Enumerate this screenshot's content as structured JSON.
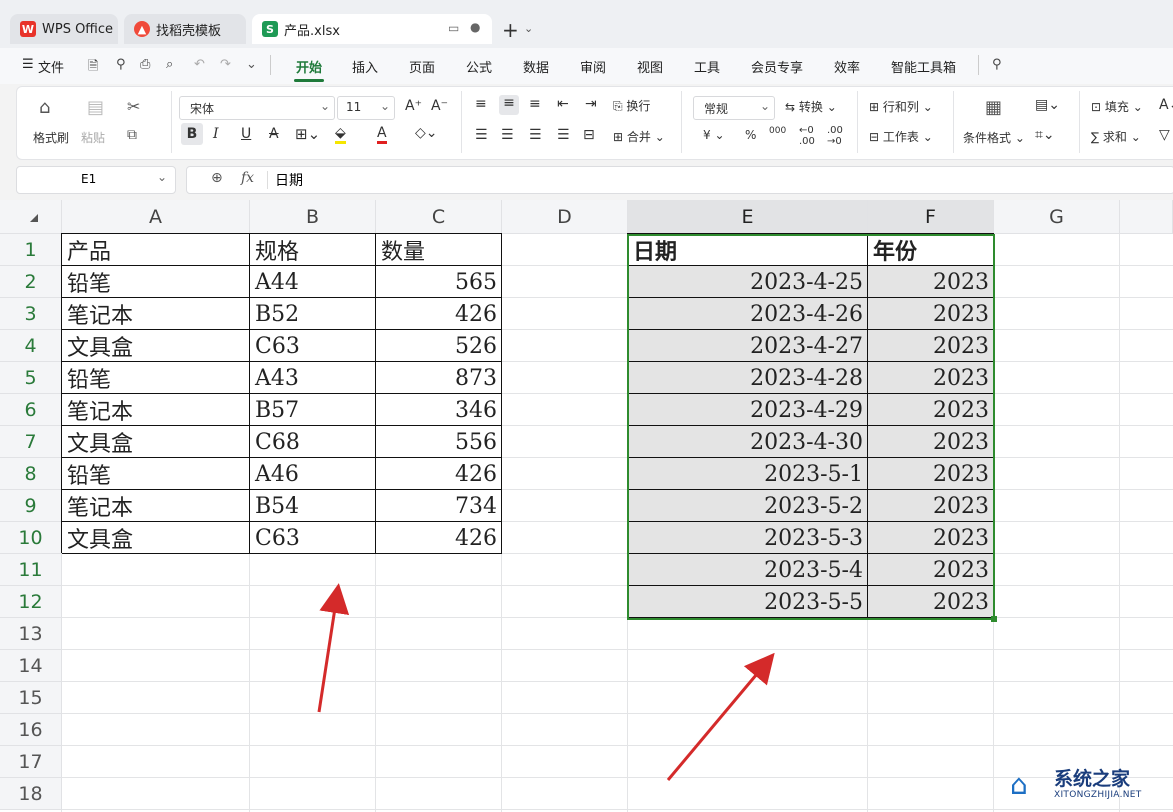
{
  "tabs": [
    {
      "label": "WPS Office",
      "icon": "wps-logo-icon"
    },
    {
      "label": "找稻壳模板",
      "icon": "docer-icon"
    },
    {
      "label": "产品.xlsx",
      "icon": "spreadsheet-icon"
    }
  ],
  "menu": {
    "file": "文件",
    "items": [
      "开始",
      "插入",
      "页面",
      "公式",
      "数据",
      "审阅",
      "视图",
      "工具",
      "会员专享",
      "效率",
      "智能工具箱"
    ],
    "active": "开始"
  },
  "ribbon": {
    "format_painter": "格式刷",
    "paste": "粘贴",
    "font_name": "宋体",
    "font_size": "11",
    "bold": "B",
    "italic": "I",
    "underline": "U",
    "strike": "A",
    "wrap": "换行",
    "merge": "合并",
    "number_format": "常规",
    "convert": "转换",
    "rows_cols": "行和列",
    "worksheet": "工作表",
    "conditional_format": "条件格式",
    "fill": "填充",
    "sum": "求和",
    "currency": "¥",
    "percent": "%",
    "thousands": "000"
  },
  "formula_bar": {
    "name_box": "E1",
    "fx": "fx",
    "content": "日期"
  },
  "columns": [
    "A",
    "B",
    "C",
    "D",
    "E",
    "F",
    "G"
  ],
  "rows": [
    "1",
    "2",
    "3",
    "4",
    "5",
    "6",
    "7",
    "8",
    "9",
    "10",
    "11",
    "12",
    "13",
    "14",
    "15",
    "16",
    "17",
    "18"
  ],
  "table_left": {
    "headers": [
      "产品",
      "规格",
      "数量"
    ],
    "rows": [
      [
        "铅笔",
        "A44",
        "565"
      ],
      [
        "笔记本",
        "B52",
        "426"
      ],
      [
        "文具盒",
        "C63",
        "526"
      ],
      [
        "铅笔",
        "A43",
        "873"
      ],
      [
        "笔记本",
        "B57",
        "346"
      ],
      [
        "文具盒",
        "C68",
        "556"
      ],
      [
        "铅笔",
        "A46",
        "426"
      ],
      [
        "笔记本",
        "B54",
        "734"
      ],
      [
        "文具盒",
        "C63",
        "426"
      ]
    ]
  },
  "table_right": {
    "headers": [
      "日期",
      "年份"
    ],
    "rows": [
      [
        "2023-4-25",
        "2023"
      ],
      [
        "2023-4-26",
        "2023"
      ],
      [
        "2023-4-27",
        "2023"
      ],
      [
        "2023-4-28",
        "2023"
      ],
      [
        "2023-4-29",
        "2023"
      ],
      [
        "2023-4-30",
        "2023"
      ],
      [
        "2023-5-1",
        "2023"
      ],
      [
        "2023-5-2",
        "2023"
      ],
      [
        "2023-5-3",
        "2023"
      ],
      [
        "2023-5-4",
        "2023"
      ],
      [
        "2023-5-5",
        "2023"
      ]
    ]
  },
  "watermark": {
    "title": "系统之家",
    "url": "XITONGZHIJIA.NET"
  },
  "colors": {
    "accent_green": "#1f7a3a",
    "selection_border": "#2e8b2e",
    "arrow_red": "#d42a2a"
  }
}
